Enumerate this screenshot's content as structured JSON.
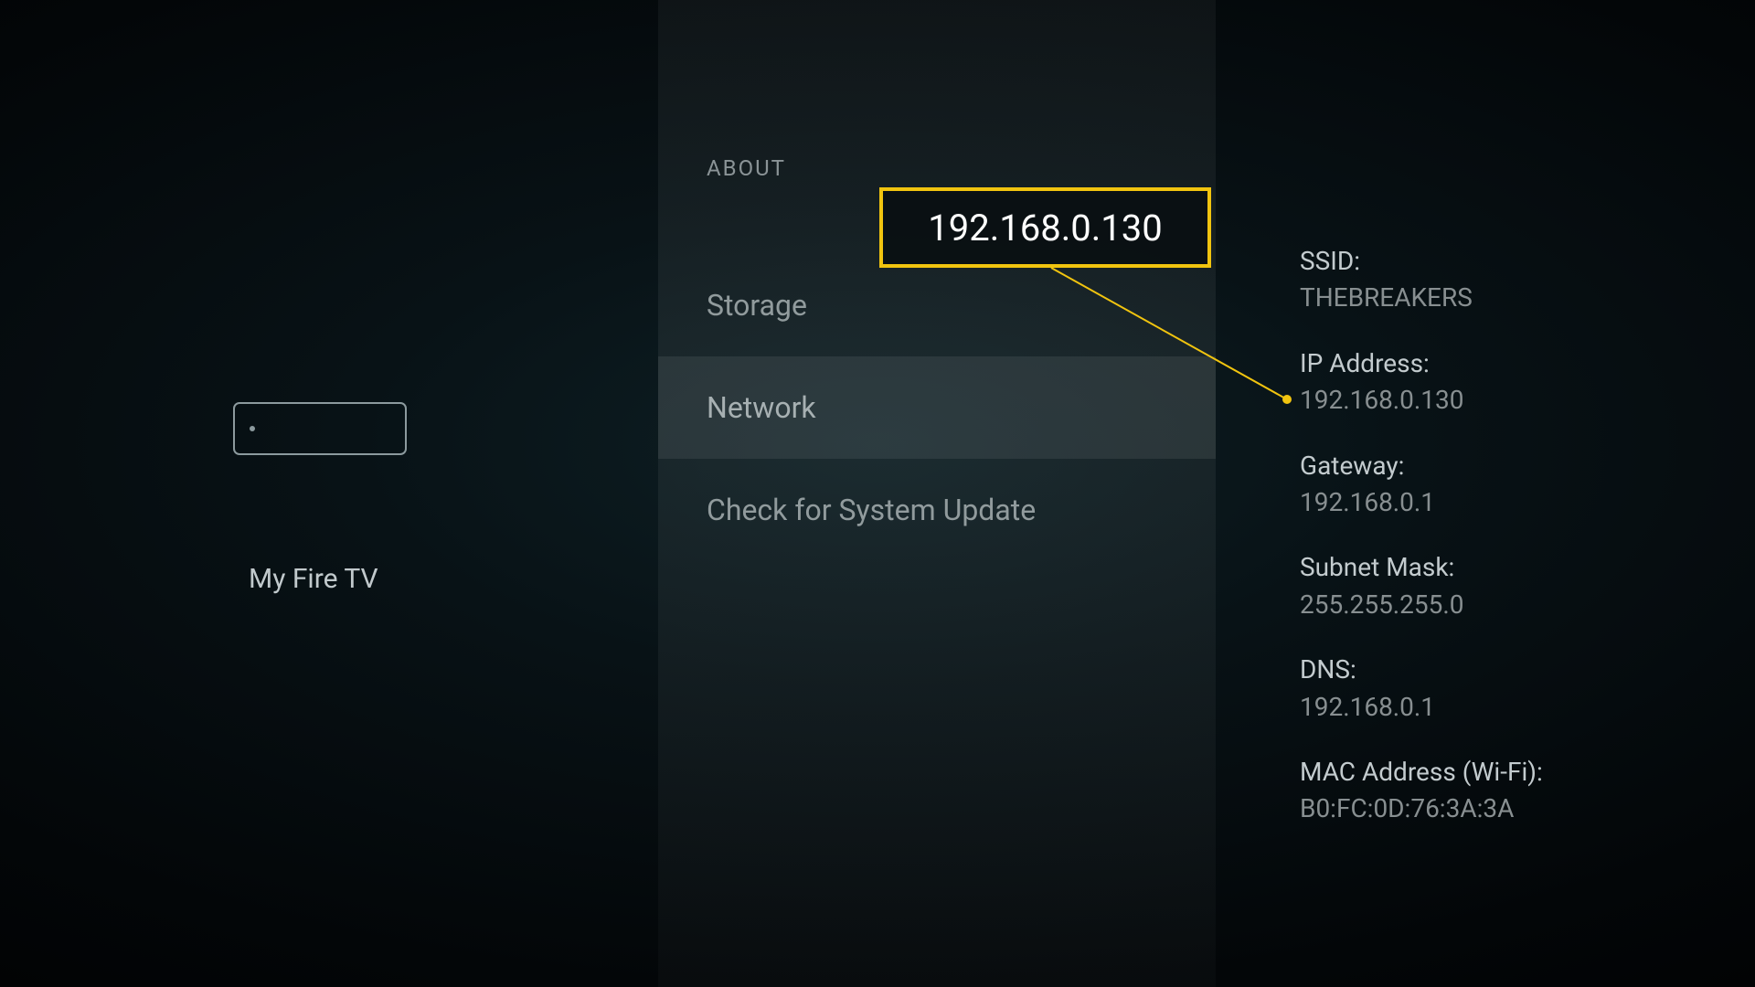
{
  "left": {
    "device_label": "My Fire TV"
  },
  "middle": {
    "section_title": "ABOUT",
    "items": [
      {
        "label": "Storage"
      },
      {
        "label": "Network"
      },
      {
        "label": "Check for System Update"
      }
    ]
  },
  "details": {
    "ssid": {
      "label": "SSID:",
      "value": "THEBREAKERS"
    },
    "ip": {
      "label": "IP Address:",
      "value": "192.168.0.130"
    },
    "gw": {
      "label": "Gateway:",
      "value": "192.168.0.1"
    },
    "mask": {
      "label": "Subnet Mask:",
      "value": "255.255.255.0"
    },
    "dns": {
      "label": "DNS:",
      "value": "192.168.0.1"
    },
    "mac": {
      "label": "MAC Address (Wi-Fi):",
      "value": "B0:FC:0D:76:3A:3A"
    }
  },
  "callout": {
    "text": "192.168.0.130",
    "highlight_color": "#f1c40f"
  }
}
